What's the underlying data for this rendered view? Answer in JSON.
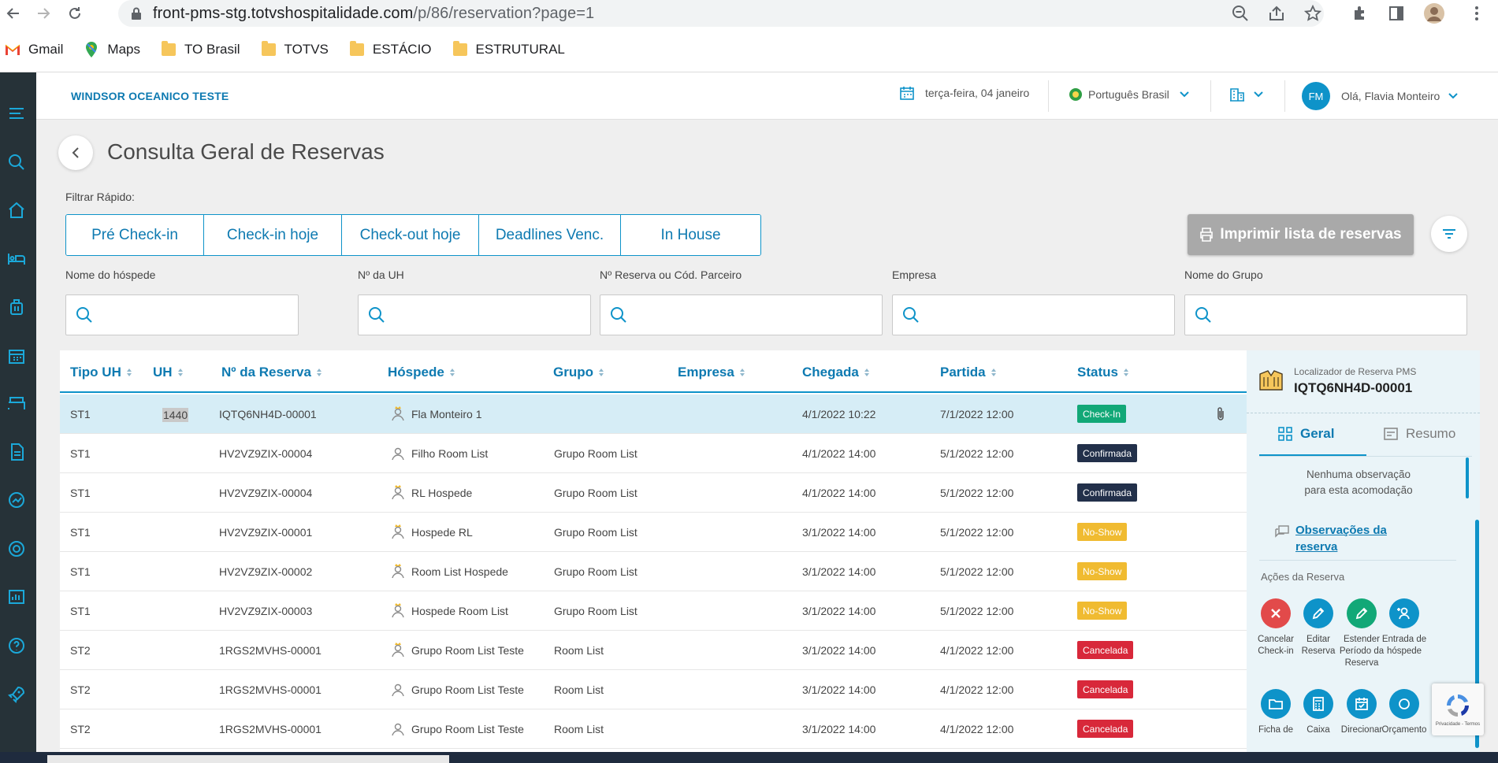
{
  "browser": {
    "url_host": "front-pms-stg.totvshospitalidade.com",
    "url_path": "/p/86/reservation?page=1",
    "bookmarks": [
      {
        "label": "Gmail",
        "icon": "gmail-icon"
      },
      {
        "label": "Maps",
        "icon": "maps-icon"
      },
      {
        "label": "TO Brasil",
        "icon": "folder-icon"
      },
      {
        "label": "TOTVS",
        "icon": "folder-icon"
      },
      {
        "label": "ESTÁCIO",
        "icon": "folder-icon"
      },
      {
        "label": "ESTRUTURAL",
        "icon": "folder-icon"
      }
    ]
  },
  "header": {
    "hotel_name": "WINDSOR OCEANICO TESTE",
    "date": "terça-feira, 04 janeiro",
    "language": "Português Brasil",
    "user_initials": "FM",
    "greeting": "Olá, Flavia Monteiro"
  },
  "page": {
    "title": "Consulta Geral de Reservas",
    "quick_filter_label": "Filtrar Rápido:",
    "quick_filters": [
      "Pré Check-in",
      "Check-in hoje",
      "Check-out hoje",
      "Deadlines Venc.",
      "In House"
    ],
    "print_label": "Imprimir lista de reservas"
  },
  "search_fields": [
    {
      "label": "Nome do hóspede",
      "value": ""
    },
    {
      "label": "Nº da UH",
      "value": ""
    },
    {
      "label": "Nº Reserva ou Cód. Parceiro",
      "value": ""
    },
    {
      "label": "Empresa",
      "value": ""
    },
    {
      "label": "Nome do Grupo",
      "value": ""
    }
  ],
  "table": {
    "headers": [
      "Tipo UH",
      "UH",
      "Nº da Reserva",
      "Hóspede",
      "Grupo",
      "Empresa",
      "Chegada",
      "Partida",
      "Status"
    ],
    "rows": [
      {
        "tipo": "ST1",
        "uh": "1440",
        "reserva": "IQTQ6NH4D-00001",
        "hospede": "Fla Monteiro 1",
        "grupo": "",
        "empresa": "",
        "chegada": "4/1/2022 10:22",
        "partida": "7/1/2022 12:00",
        "status": "Check-In",
        "status_kind": "checkin",
        "main_guest": true,
        "attachment": true
      },
      {
        "tipo": "ST1",
        "uh": "",
        "reserva": "HV2VZ9ZIX-00004",
        "hospede": "Filho Room List",
        "grupo": "Grupo Room List",
        "empresa": "",
        "chegada": "4/1/2022 14:00",
        "partida": "5/1/2022 12:00",
        "status": "Confirmada",
        "status_kind": "confirmada",
        "main_guest": false,
        "attachment": false
      },
      {
        "tipo": "ST1",
        "uh": "",
        "reserva": "HV2VZ9ZIX-00004",
        "hospede": "RL Hospede",
        "grupo": "Grupo Room List",
        "empresa": "",
        "chegada": "4/1/2022 14:00",
        "partida": "5/1/2022 12:00",
        "status": "Confirmada",
        "status_kind": "confirmada",
        "main_guest": true,
        "attachment": false
      },
      {
        "tipo": "ST1",
        "uh": "",
        "reserva": "HV2VZ9ZIX-00001",
        "hospede": "Hospede RL",
        "grupo": "Grupo Room List",
        "empresa": "",
        "chegada": "3/1/2022 14:00",
        "partida": "5/1/2022 12:00",
        "status": "No-Show",
        "status_kind": "noshow",
        "main_guest": true,
        "attachment": false
      },
      {
        "tipo": "ST1",
        "uh": "",
        "reserva": "HV2VZ9ZIX-00002",
        "hospede": "Room List Hospede",
        "grupo": "Grupo Room List",
        "empresa": "",
        "chegada": "3/1/2022 14:00",
        "partida": "5/1/2022 12:00",
        "status": "No-Show",
        "status_kind": "noshow",
        "main_guest": true,
        "attachment": false
      },
      {
        "tipo": "ST1",
        "uh": "",
        "reserva": "HV2VZ9ZIX-00003",
        "hospede": "Hospede Room List",
        "grupo": "Grupo Room List",
        "empresa": "",
        "chegada": "3/1/2022 14:00",
        "partida": "5/1/2022 12:00",
        "status": "No-Show",
        "status_kind": "noshow",
        "main_guest": true,
        "attachment": false
      },
      {
        "tipo": "ST2",
        "uh": "",
        "reserva": "1RGS2MVHS-00001",
        "hospede": "Grupo Room List Teste",
        "grupo": "Room List",
        "empresa": "",
        "chegada": "3/1/2022 14:00",
        "partida": "4/1/2022 12:00",
        "status": "Cancelada",
        "status_kind": "cancelada",
        "main_guest": true,
        "attachment": false
      },
      {
        "tipo": "ST2",
        "uh": "",
        "reserva": "1RGS2MVHS-00001",
        "hospede": "Grupo Room List Teste",
        "grupo": "Room List",
        "empresa": "",
        "chegada": "3/1/2022 14:00",
        "partida": "4/1/2022 12:00",
        "status": "Cancelada",
        "status_kind": "cancelada",
        "main_guest": false,
        "attachment": false
      },
      {
        "tipo": "ST2",
        "uh": "",
        "reserva": "1RGS2MVHS-00001",
        "hospede": "Grupo Room List Teste",
        "grupo": "Room List",
        "empresa": "",
        "chegada": "3/1/2022 14:00",
        "partida": "4/1/2022 12:00",
        "status": "Cancelada",
        "status_kind": "cancelada",
        "main_guest": false,
        "attachment": false
      }
    ]
  },
  "panel": {
    "locator_label": "Localizador de Reserva PMS",
    "locator_code": "IQTQ6NH4D-00001",
    "tab_geral": "Geral",
    "tab_resumo": "Resumo",
    "note_line1": "Nenhuma observação",
    "note_line2": "para esta acomodação",
    "obs_link": "Observações da reserva",
    "actions_title": "Ações da Reserva",
    "actions": [
      {
        "label": "Cancelar Check-in",
        "color": "#e24a4a",
        "icon": "close-icon"
      },
      {
        "label": "Editar Reserva",
        "color": "#0e93c9",
        "icon": "pencil-icon"
      },
      {
        "label": "Estender Período da Reserva",
        "color": "#12a877",
        "icon": "pencil-icon"
      },
      {
        "label": "Entrada de hóspede",
        "color": "#0e93c9",
        "icon": "add-user-icon"
      },
      {
        "label": "Ficha de",
        "color": "#0e93c9",
        "icon": "folder-icon"
      },
      {
        "label": "Caixa",
        "color": "#0e93c9",
        "icon": "calculator-icon"
      },
      {
        "label": "Direcionar",
        "color": "#0e93c9",
        "icon": "calendar-check-icon"
      },
      {
        "label": "Orçamento",
        "color": "#0e93c9",
        "icon": "budget-icon"
      }
    ],
    "recaptcha_text": "Privacidade - Termos"
  },
  "colors": {
    "primary": "#0e93c9",
    "sidebar": "#263238",
    "checkin": "#12a877",
    "confirmada": "#22304a",
    "noshow": "#f0bb31",
    "cancelada": "#d8283a"
  }
}
